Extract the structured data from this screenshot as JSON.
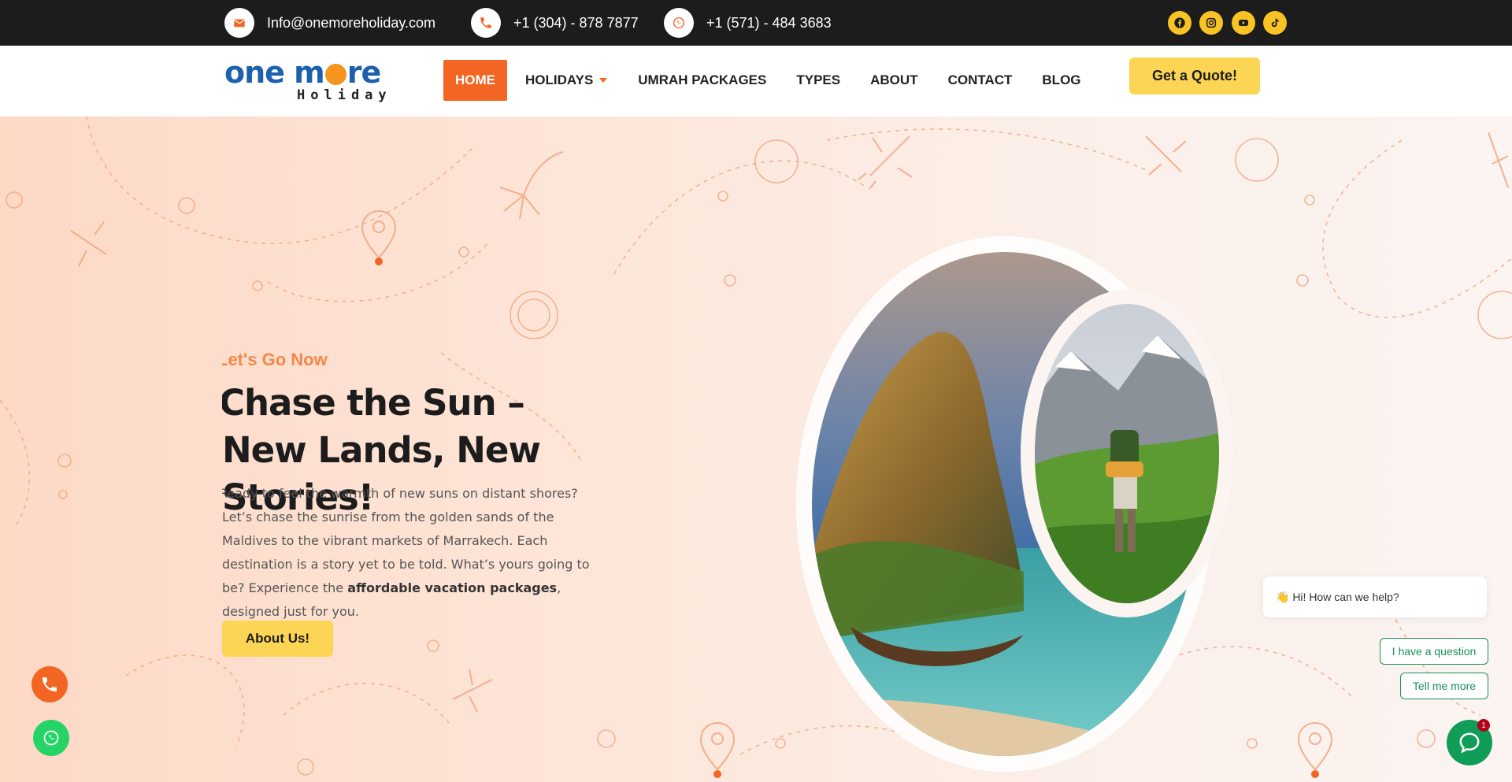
{
  "topbar": {
    "email": "Info@onemoreholiday.com",
    "phone": "+1 (304) - 878 7877",
    "whatsapp": "+1 (571) - 484 3683",
    "social": [
      "facebook-icon",
      "instagram-icon",
      "youtube-icon",
      "tiktok-icon"
    ]
  },
  "header": {
    "logo_top": "one more",
    "logo_sub": "Holiday",
    "nav": [
      "HOME",
      "HOLIDAYS",
      "UMRAH PACKAGES",
      "TYPES",
      "ABOUT",
      "CONTACT",
      "BLOG"
    ],
    "active_nav": "HOME",
    "quote_button": "Get a Quote!"
  },
  "hero": {
    "eyebrow": "Let's Go Now",
    "headline": "Chase the Sun – New Lands, New Stories!",
    "paragraph_pre": "Ready to feel the warmth of new suns on distant shores? Let’s chase the sunrise from the golden sands of the Maldives to the vibrant markets of Marrakech. Each destination is a story yet to be told. What’s yours going to be? Experience the ",
    "paragraph_bold": "affordable vacation packages",
    "paragraph_post": ", designed just for you.",
    "about_button": "About Us!"
  },
  "chat": {
    "greeting": "👋 Hi! How can we help?",
    "options": [
      "I have a question",
      "Tell me more"
    ],
    "badge_count": "1"
  },
  "colors": {
    "accent_orange": "#f26522",
    "brand_blue": "#1d61ad",
    "button_yellow": "#fcd555",
    "whatsapp_green": "#0f9d58",
    "topbar_bg": "#1c1c1c"
  }
}
